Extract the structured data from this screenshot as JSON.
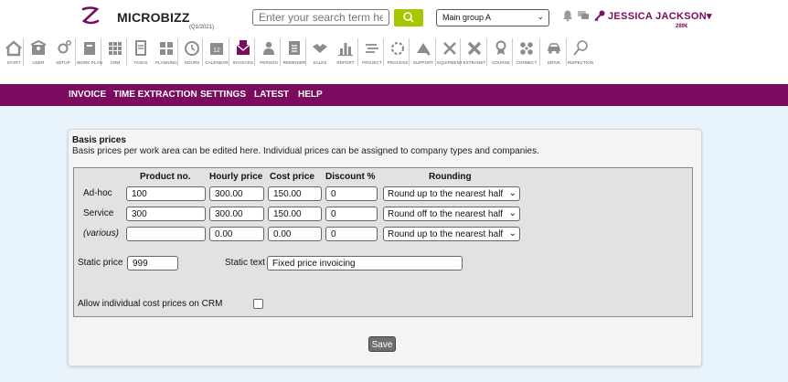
{
  "app": {
    "name": "MICROBIZZ",
    "version_note": "(Q1/2021)"
  },
  "header": {
    "search_placeholder": "Enter your search term here",
    "group_select": "Main group A",
    "user_name": "JESSICA JACKSON▾",
    "credit": "289€",
    "colors": {
      "brand": "#7b0b5e",
      "search_button": "#a7c700"
    }
  },
  "toolbar": [
    {
      "label": "START",
      "icon": "home-icon"
    },
    {
      "label": "USER",
      "icon": "user-card-icon"
    },
    {
      "label": "SETUP",
      "icon": "gear-icon"
    },
    {
      "label": "WORK PLAN",
      "icon": "work-plan-icon"
    },
    {
      "label": "CRM",
      "icon": "crm-icon"
    },
    {
      "label": "TASKS",
      "icon": "tasks-icon"
    },
    {
      "label": "PLANNING",
      "icon": "planning-icon"
    },
    {
      "label": "HOURS",
      "icon": "clock-icon"
    },
    {
      "label": "CALENDAR",
      "icon": "calendar-icon"
    },
    {
      "label": "INVOICES",
      "icon": "invoice-envelope-icon"
    },
    {
      "label": "PERSON",
      "icon": "person-icon"
    },
    {
      "label": "REMINDER",
      "icon": "reminder-icon"
    },
    {
      "label": "SALES",
      "icon": "handshake-icon"
    },
    {
      "label": "REPORT",
      "icon": "bar-chart-icon"
    },
    {
      "label": "PROJECT",
      "icon": "project-icon"
    },
    {
      "label": "PROCESS",
      "icon": "process-icon"
    },
    {
      "label": "SUPPORT",
      "icon": "support-icon"
    },
    {
      "label": "EQUIPMENT",
      "icon": "tools-icon"
    },
    {
      "label": "EXTRANET",
      "icon": "extranet-icon"
    },
    {
      "label": "COURSE",
      "icon": "course-icon"
    },
    {
      "label": "CONNECT",
      "icon": "connect-icon"
    },
    {
      "label": "DRIVE",
      "icon": "car-icon"
    },
    {
      "label": "INSPECTION",
      "icon": "magnifier-icon"
    }
  ],
  "nav": [
    "INVOICE",
    "TIME EXTRACTION",
    "SETTINGS",
    "LATEST",
    "HELP"
  ],
  "basis": {
    "title": "Basis prices",
    "description": "Basis prices per work area can be edited here. Individual prices can be assigned to company types and companies.",
    "columns": [
      "Product no.",
      "Hourly price",
      "Cost price",
      "Discount %",
      "Rounding"
    ],
    "rows": [
      {
        "label": "Ad-hoc",
        "product": "100",
        "hourly": "300.00",
        "cost": "150.00",
        "discount": "0",
        "rounding": "Round up to the nearest half"
      },
      {
        "label": "Service",
        "product": "300",
        "hourly": "300.00",
        "cost": "150.00",
        "discount": "0",
        "rounding": "Round off to the nearest half"
      },
      {
        "label": "(various)",
        "product": "",
        "hourly": "0.00",
        "cost": "0.00",
        "discount": "0",
        "rounding": "Round up to the nearest half"
      }
    ],
    "static_price_label": "Static price",
    "static_price": "999",
    "static_text_label": "Static text",
    "static_text": "Fixed price invoicing",
    "allow_cost_label": "Allow individual cost prices on CRM",
    "allow_cost_checked": false,
    "save_label": "Save"
  }
}
